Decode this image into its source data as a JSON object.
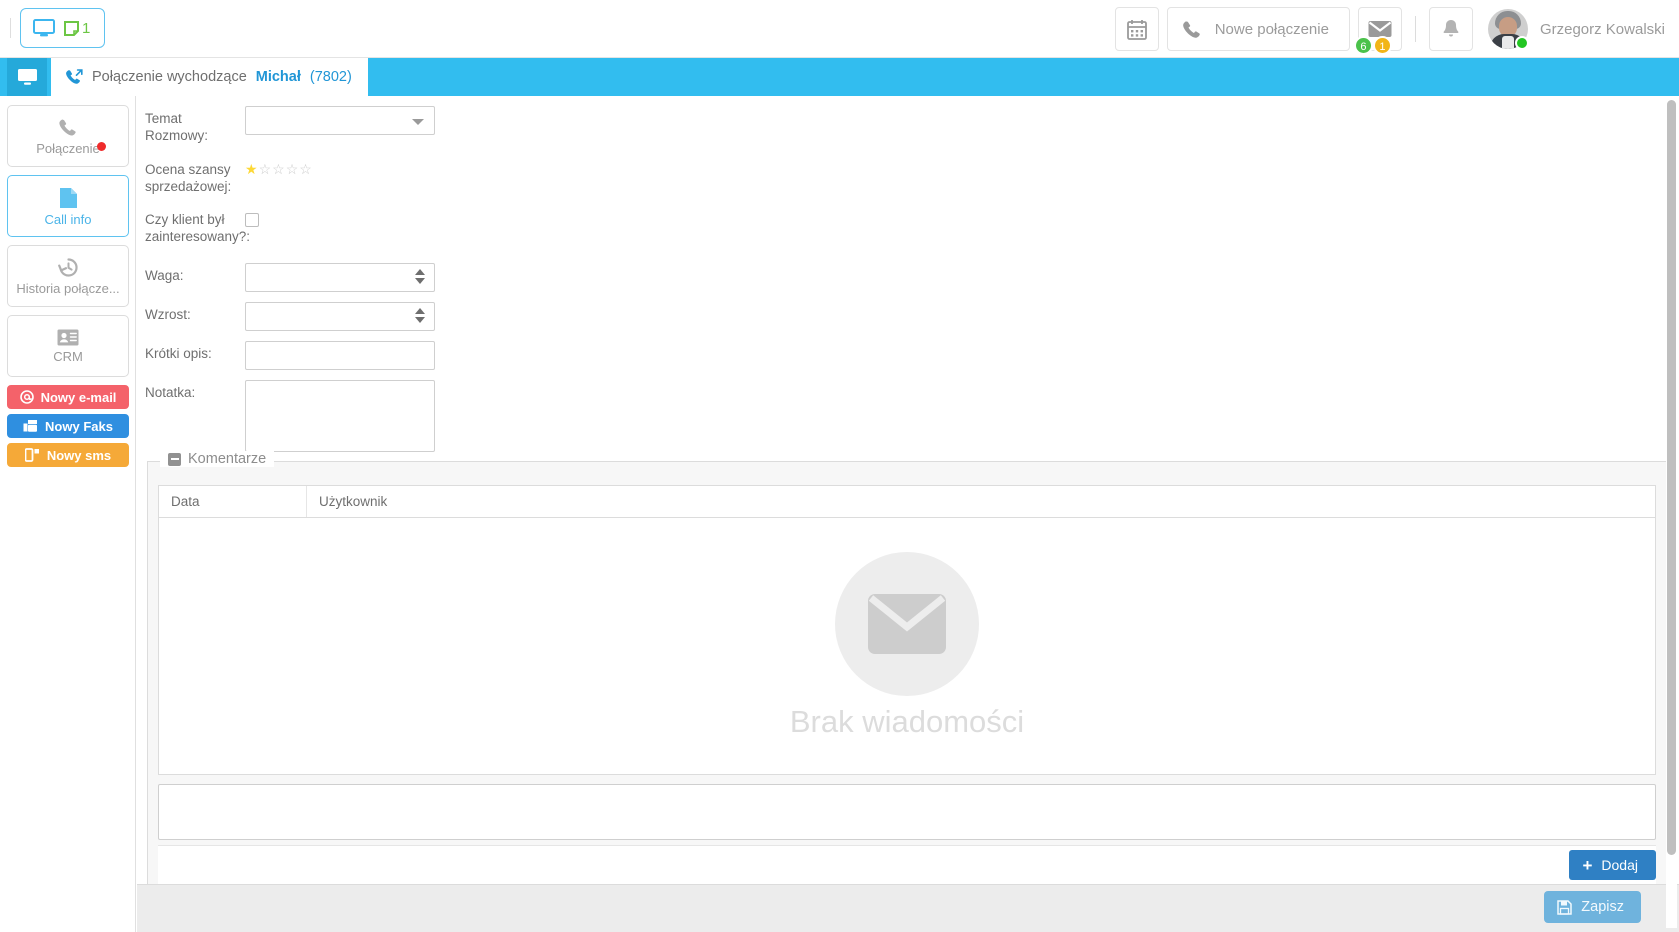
{
  "header": {
    "screen_pill": {
      "monitor_icon": "monitor-icon",
      "note_icon": "note-icon",
      "note_count": "1"
    },
    "calendar_button_icon": "calendar-icon",
    "new_call_label": "Nowe połączenie",
    "new_call_icon": "phone-icon",
    "mail_icon": "envelope-icon",
    "mail_badge_green": "6",
    "mail_badge_amber": "1",
    "bell_icon": "bell-icon",
    "user_name": "Grzegorz Kowalski",
    "status": "online"
  },
  "tabs": {
    "home_icon": "monitor-icon",
    "active": {
      "icon": "outgoing-call-icon",
      "label": "Połączenie wychodzące",
      "contact": "Michał",
      "extension": "(7802)"
    }
  },
  "sidebar": {
    "items": [
      {
        "label": "Połączenie",
        "icon": "phone-icon",
        "active": false,
        "dot": true
      },
      {
        "label": "Call info",
        "icon": "document-icon",
        "active": true,
        "dot": false
      },
      {
        "label": "Historia połącze...",
        "icon": "history-icon",
        "active": false,
        "dot": false
      },
      {
        "label": "CRM",
        "icon": "contact-card-icon",
        "active": false,
        "dot": false
      }
    ],
    "actions": [
      {
        "label": "Nowy e-mail",
        "icon": "at-icon",
        "color": "#f4626a"
      },
      {
        "label": "Nowy Faks",
        "icon": "fax-icon",
        "color": "#2f8fe0"
      },
      {
        "label": "Nowy sms",
        "icon": "sms-icon",
        "color": "#f5a938"
      }
    ]
  },
  "form": {
    "fields": [
      {
        "label": "Temat Rozmowy:",
        "type": "select",
        "value": ""
      },
      {
        "label": "Ocena szansy sprzedażowej:",
        "type": "rating",
        "value": 1,
        "max": 5
      },
      {
        "label": "Czy klient był zainteresowany?:",
        "type": "checkbox",
        "value": false
      },
      {
        "label": "Waga:",
        "type": "number",
        "value": ""
      },
      {
        "label": "Wzrost:",
        "type": "number",
        "value": ""
      },
      {
        "label": "Krótki opis:",
        "type": "text",
        "value": ""
      },
      {
        "label": "Notatka:",
        "type": "textarea",
        "value": ""
      }
    ]
  },
  "comments": {
    "legend": "Komentarze",
    "collapse_icon": "minus-icon",
    "columns": [
      "Data",
      "Użytkownik"
    ],
    "rows": [],
    "empty_text": "Brak wiadomości",
    "empty_icon": "envelope-icon",
    "input_value": "",
    "add_button": {
      "label": "Dodaj",
      "icon": "plus-icon"
    }
  },
  "footer": {
    "save_button": {
      "label": "Zapisz",
      "icon": "save-icon"
    }
  },
  "colors": {
    "accent": "#32bdef",
    "tab_blue": "#2196d6",
    "green": "#4bc24b",
    "amber": "#f2b518",
    "red": "#ef2b2b",
    "star": "#fdd835"
  }
}
